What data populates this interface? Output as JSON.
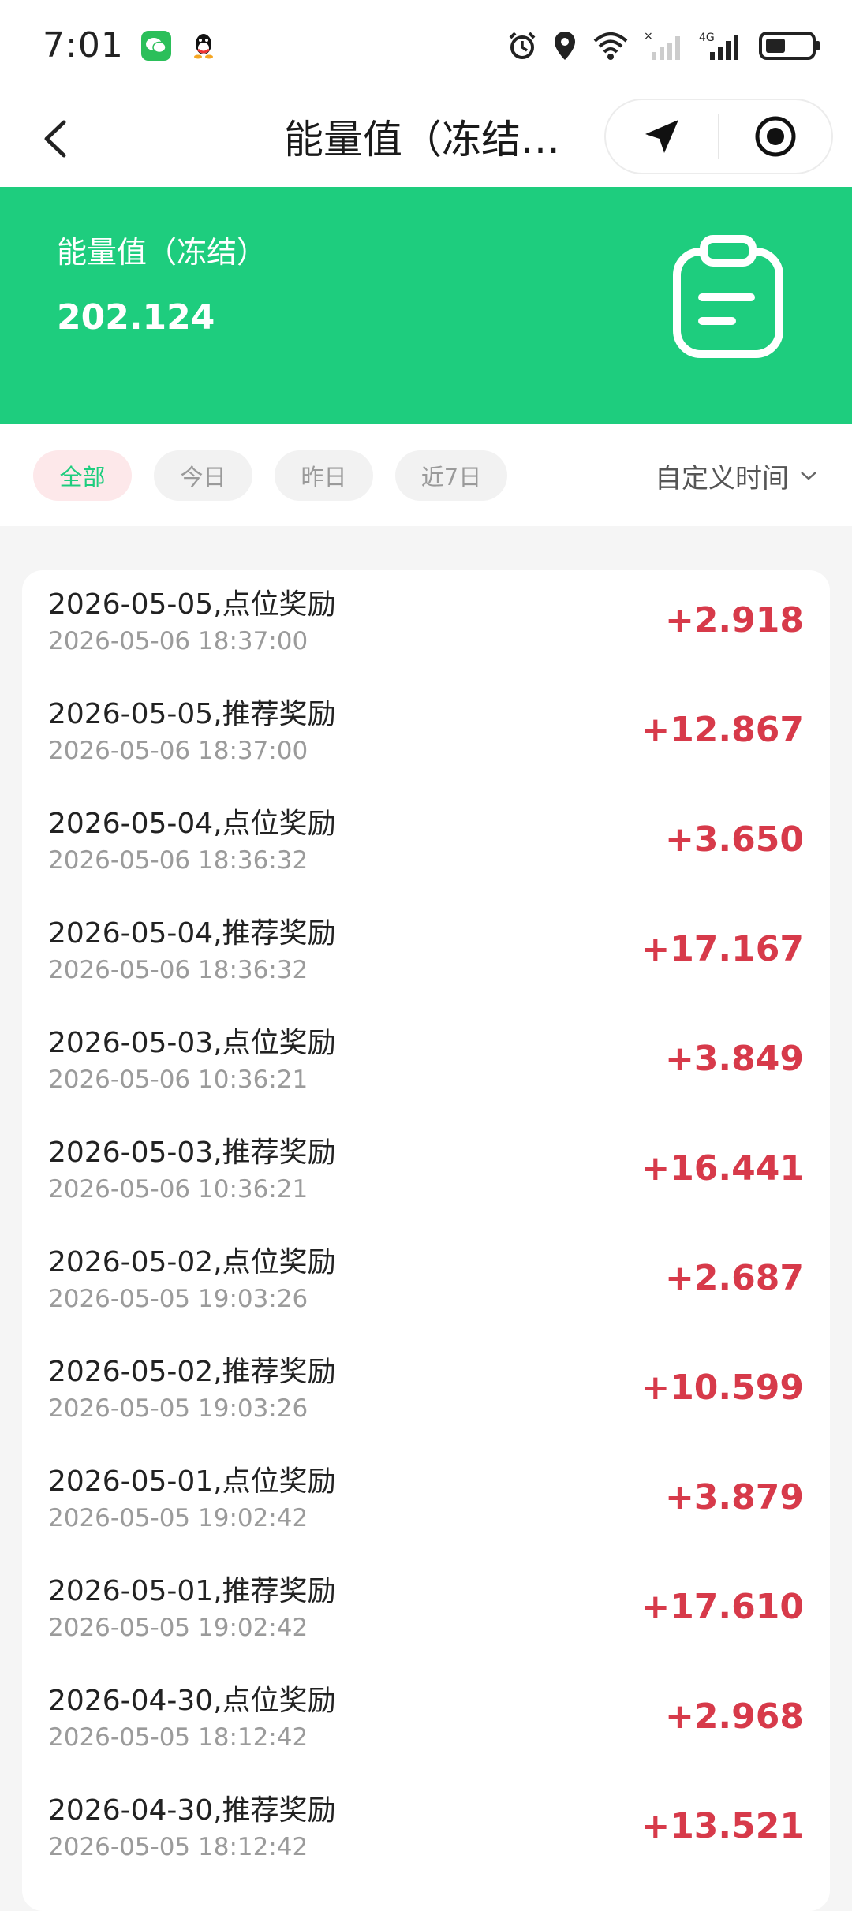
{
  "status_bar": {
    "time": "7:01",
    "icons": [
      "wechat-icon",
      "qq-icon",
      "alarm-icon",
      "location-icon",
      "wifi-icon",
      "signal-icon",
      "network-4g-icon",
      "battery-icon"
    ]
  },
  "nav": {
    "title": "能量值（冻结…",
    "icons": [
      "back-icon",
      "send-icon",
      "record-icon"
    ]
  },
  "header": {
    "label": "能量值（冻结）",
    "value": "202.124",
    "icon": "clipboard-icon",
    "background_color": "#1ecd7e"
  },
  "filters": {
    "chips": [
      "全部",
      "今日",
      "昨日",
      "近7日"
    ],
    "active_index": 0,
    "custom_label": "自定义时间"
  },
  "records": [
    {
      "title": "2026-05-05,点位奖励",
      "time": "2026-05-06 18:37:00",
      "amount": "+2.918"
    },
    {
      "title": "2026-05-05,推荐奖励",
      "time": "2026-05-06 18:37:00",
      "amount": "+12.867"
    },
    {
      "title": "2026-05-04,点位奖励",
      "time": "2026-05-06 18:36:32",
      "amount": "+3.650"
    },
    {
      "title": "2026-05-04,推荐奖励",
      "time": "2026-05-06 18:36:32",
      "amount": "+17.167"
    },
    {
      "title": "2026-05-03,点位奖励",
      "time": "2026-05-06 10:36:21",
      "amount": "+3.849"
    },
    {
      "title": "2026-05-03,推荐奖励",
      "time": "2026-05-06 10:36:21",
      "amount": "+16.441"
    },
    {
      "title": "2026-05-02,点位奖励",
      "time": "2026-05-05 19:03:26",
      "amount": "+2.687"
    },
    {
      "title": "2026-05-02,推荐奖励",
      "time": "2026-05-05 19:03:26",
      "amount": "+10.599"
    },
    {
      "title": "2026-05-01,点位奖励",
      "time": "2026-05-05 19:02:42",
      "amount": "+3.879"
    },
    {
      "title": "2026-05-01,推荐奖励",
      "time": "2026-05-05 19:02:42",
      "amount": "+17.610"
    },
    {
      "title": "2026-04-30,点位奖励",
      "time": "2026-05-05 18:12:42",
      "amount": "+2.968"
    },
    {
      "title": "2026-04-30,推荐奖励",
      "time": "2026-05-05 18:12:42",
      "amount": "+13.521"
    }
  ],
  "colors": {
    "amount": "#d73a4a",
    "accent": "#1ecd7e",
    "active_chip_bg": "#fde8ea"
  }
}
